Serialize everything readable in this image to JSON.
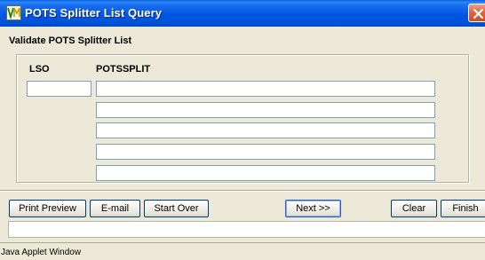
{
  "window": {
    "title": "POTS Splitter List Query"
  },
  "form": {
    "header": "Validate POTS Splitter List",
    "columns": {
      "lso": "LSO",
      "potssplit": "POTSSPLIT"
    },
    "lso_value": "",
    "potssplit_values": [
      "",
      "",
      "",
      "",
      ""
    ]
  },
  "buttons": {
    "print_preview": "Print Preview",
    "email": "E-mail",
    "start_over": "Start Over",
    "next": "Next >>",
    "clear": "Clear",
    "finish": "Finish"
  },
  "message": "",
  "status": {
    "text": "Java Applet Window"
  },
  "icons": {
    "app": "app-icon",
    "close": "close-icon"
  },
  "colors": {
    "title_bar": "#0054e3",
    "window_bg": "#ece9d8",
    "close_button": "#e2653f",
    "field_border": "#7f9db9"
  }
}
